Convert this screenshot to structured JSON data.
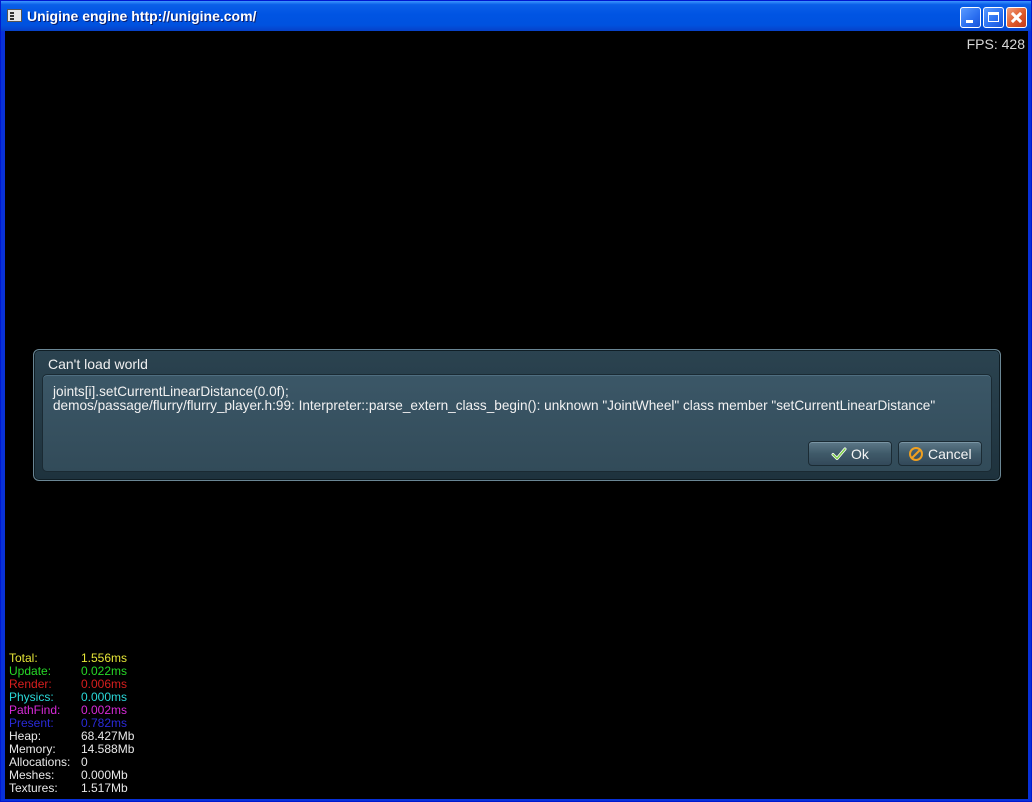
{
  "window": {
    "title": "Unigine engine http://unigine.com/",
    "icon": "app-window-icon"
  },
  "hud": {
    "fps": "FPS: 428"
  },
  "dialog": {
    "title": "Can't load world",
    "message_line1": "joints[i].setCurrentLinearDistance(0.0f);",
    "message_line2": "demos/passage/flurry/flurry_player.h:99: Interpreter::parse_extern_class_begin(): unknown \"JointWheel\" class member \"setCurrentLinearDistance\"",
    "ok_label": "Ok",
    "cancel_label": "Cancel"
  },
  "stats": [
    {
      "label": "Total:",
      "value": "1.556ms",
      "color": "#e6e637"
    },
    {
      "label": "Update:",
      "value": "0.022ms",
      "color": "#27d827"
    },
    {
      "label": "Render:",
      "value": "0.006ms",
      "color": "#d81e1e"
    },
    {
      "label": "Physics:",
      "value": "0.000ms",
      "color": "#2ad8d8"
    },
    {
      "label": "PathFind:",
      "value": "0.002ms",
      "color": "#d82ad8"
    },
    {
      "label": "Present:",
      "value": "0.782ms",
      "color": "#2a2ad8"
    },
    {
      "label": "Heap:",
      "value": "68.427Mb",
      "color": "#e8e8e8"
    },
    {
      "label": "Memory:",
      "value": "14.588Mb",
      "color": "#e8e8e8"
    },
    {
      "label": "Allocations:",
      "value": "0",
      "color": "#e8e8e8"
    },
    {
      "label": "Meshes:",
      "value": "0.000Mb",
      "color": "#e8e8e8"
    },
    {
      "label": "Textures:",
      "value": "1.517Mb",
      "color": "#e8e8e8"
    }
  ]
}
